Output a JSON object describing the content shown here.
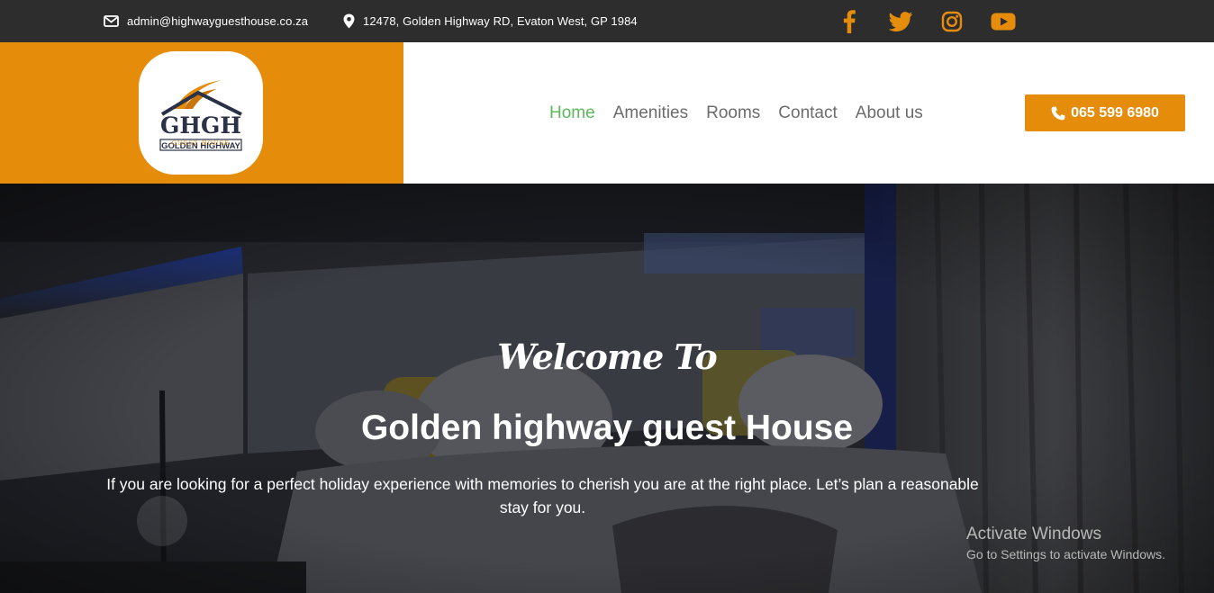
{
  "topbar": {
    "email": "admin@highwayguesthouse.co.za",
    "address": "12478, Golden Highway RD, Evaton West, GP 1984",
    "socials": [
      "facebook-icon",
      "twitter-icon",
      "instagram-icon",
      "youtube-icon"
    ],
    "icon_color": "#e58d0b"
  },
  "logo": {
    "monogram": "GHGH",
    "name": "GOLDEN HIGHWAY",
    "tagline": "GUEST HOUSE"
  },
  "nav": {
    "items": [
      {
        "label": "Home",
        "active": true
      },
      {
        "label": "Amenities",
        "active": false
      },
      {
        "label": "Rooms",
        "active": false
      },
      {
        "label": "Contact",
        "active": false
      },
      {
        "label": "About us",
        "active": false
      }
    ],
    "active_color": "#5cb85c"
  },
  "phone": {
    "label": "065 599 6980",
    "icon": "phone-icon"
  },
  "hero": {
    "welcome": "Welcome To",
    "title": "Golden highway guest House",
    "text": "If you are looking for a perfect holiday experience with memories to cherish you are at the right place. Let’s plan a reasonable stay for you."
  },
  "watermark": {
    "line1": "Activate Windows",
    "line2": "Go to Settings to activate Windows."
  },
  "colors": {
    "accent": "#e58d0b",
    "topbar": "#2d2d2d"
  }
}
